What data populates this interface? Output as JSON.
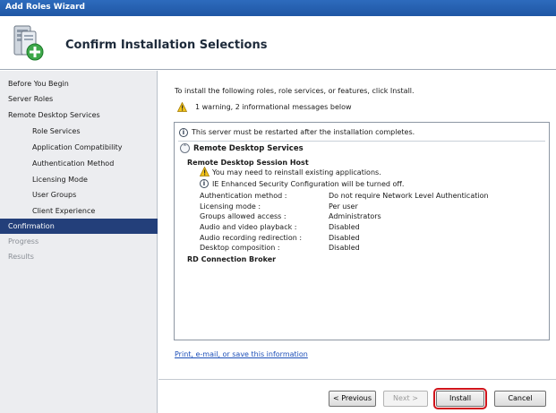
{
  "window": {
    "title": "Add Roles Wizard"
  },
  "header": {
    "title": "Confirm Installation Selections",
    "icon": "server-role-icon"
  },
  "sidebar": {
    "items": [
      {
        "label": "Before You Begin",
        "state": "normal",
        "indent": false
      },
      {
        "label": "Server Roles",
        "state": "normal",
        "indent": false
      },
      {
        "label": "Remote Desktop Services",
        "state": "normal",
        "indent": false
      },
      {
        "label": "Role Services",
        "state": "normal",
        "indent": true
      },
      {
        "label": "Application Compatibility",
        "state": "normal",
        "indent": true
      },
      {
        "label": "Authentication Method",
        "state": "normal",
        "indent": true
      },
      {
        "label": "Licensing Mode",
        "state": "normal",
        "indent": true
      },
      {
        "label": "User Groups",
        "state": "normal",
        "indent": true
      },
      {
        "label": "Client Experience",
        "state": "normal",
        "indent": true
      },
      {
        "label": "Confirmation",
        "state": "active",
        "indent": false
      },
      {
        "label": "Progress",
        "state": "disabled",
        "indent": false
      },
      {
        "label": "Results",
        "state": "disabled",
        "indent": false
      }
    ]
  },
  "main": {
    "intro": "To install the following roles, role services, or features, click Install.",
    "warning_summary": "1 warning, 2 informational messages below",
    "restart_notice": "This server must be restarted after the installation completes.",
    "section_title": "Remote Desktop Services",
    "subsection_title": "Remote Desktop Session Host",
    "warning_message": "You may need to reinstall existing applications.",
    "info_message": "IE Enhanced Security Configuration will be turned off.",
    "settings": [
      {
        "name": "Authentication method :",
        "value": "Do not require Network Level Authentication"
      },
      {
        "name": "Licensing mode :",
        "value": "Per user"
      },
      {
        "name": "Groups allowed access :",
        "value": "Administrators"
      },
      {
        "name": "Audio and video playback :",
        "value": "Disabled"
      },
      {
        "name": "Audio recording redirection :",
        "value": "Disabled"
      },
      {
        "name": "Desktop composition :",
        "value": "Disabled"
      }
    ],
    "second_subsection_title": "RD Connection Broker",
    "link": "Print, e-mail, or save this information"
  },
  "buttons": {
    "previous": "< Previous",
    "next": "Next >",
    "install": "Install",
    "cancel": "Cancel"
  },
  "colors": {
    "accent": "#233f7a",
    "highlight": "#d0141b",
    "link": "#1d4fb8"
  }
}
